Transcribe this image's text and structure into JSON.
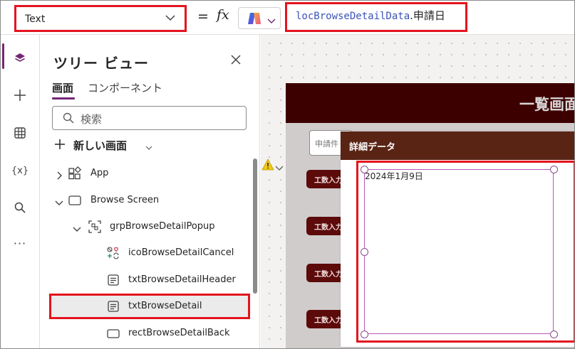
{
  "formula_bar": {
    "property_value": "Text",
    "equals": "=",
    "fx": "fx",
    "formula_variable": "locBrowseDetailData",
    "formula_rest": ".申請日"
  },
  "left_rail": {
    "items": [
      "layers-icon",
      "plus-icon",
      "table-icon",
      "variables-icon",
      "search-icon",
      "more-icon"
    ],
    "variables_label": "{x}",
    "more_label": "···"
  },
  "tree_view": {
    "title": "ツリー ビュー",
    "tabs": [
      {
        "label": "画面",
        "active": true
      },
      {
        "label": "コンポーネント",
        "active": false
      }
    ],
    "search_placeholder": "検索",
    "new_screen_label": "新しい画面",
    "nodes": [
      {
        "label": "App",
        "icon": "app-icon",
        "level": 0,
        "expanded": false
      },
      {
        "label": "Browse Screen",
        "icon": "screen-icon",
        "level": 0,
        "expanded": true
      },
      {
        "label": "grpBrowseDetailPopup",
        "icon": "group-icon",
        "level": 1,
        "expanded": true
      },
      {
        "label": "icoBrowseDetailCancel",
        "icon": "icon-control-icon",
        "level": 2
      },
      {
        "label": "txtBrowseDetailHeader",
        "icon": "text-label-icon",
        "level": 2
      },
      {
        "label": "txtBrowseDetail",
        "icon": "text-label-icon",
        "level": 2,
        "selected": true
      },
      {
        "label": "rectBrowseDetailBack",
        "icon": "rectangle-icon",
        "level": 2
      }
    ]
  },
  "canvas": {
    "app_title": "一覧画面",
    "search_placeholder": "申請件",
    "row_button_label": "工数入力",
    "popup_header": "詳細データ",
    "detail_text": "2024年1月9日"
  },
  "colors": {
    "highlight_red": "#e3141e",
    "accent_purple": "#742774",
    "app_header": "#3d0000",
    "popup_header": "#5a2414",
    "row_button": "#5c0a0a"
  }
}
